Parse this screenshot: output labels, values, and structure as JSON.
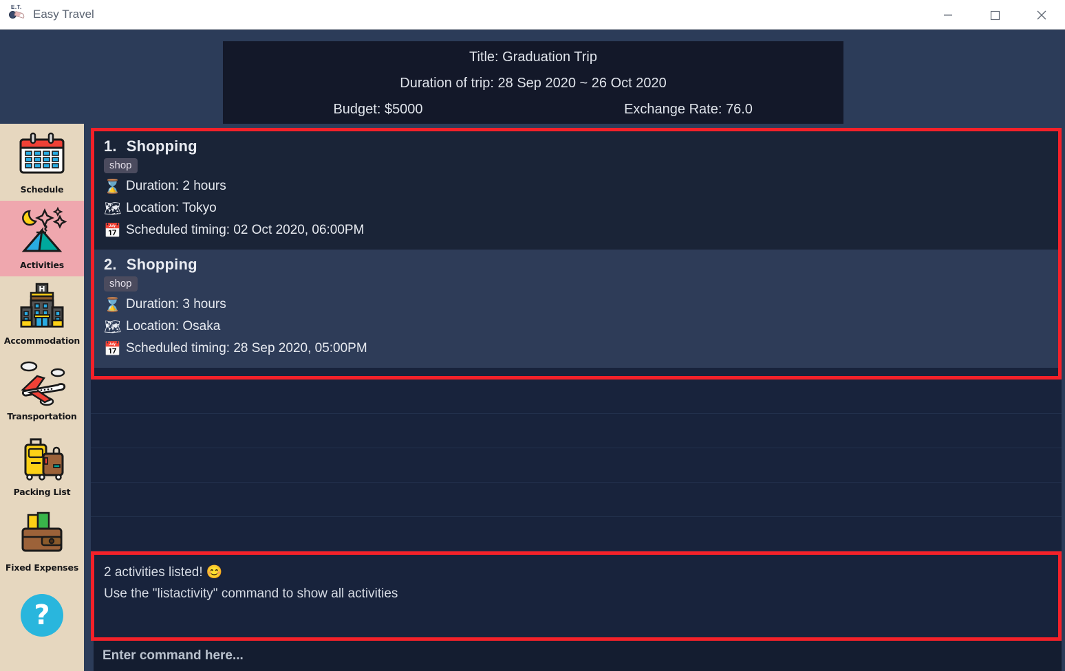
{
  "window": {
    "title": "Easy Travel",
    "logo_text": "E.T.",
    "controls": [
      {
        "name": "minimize",
        "glyph": "minimize-icon"
      },
      {
        "name": "maximize",
        "glyph": "maximize-icon"
      },
      {
        "name": "close",
        "glyph": "close-icon"
      }
    ]
  },
  "trip": {
    "title": "Title: Graduation Trip",
    "duration": "Duration of trip: 28 Sep 2020 ~ 26 Oct 2020",
    "budget": "Budget: $5000",
    "exchange_rate": "Exchange Rate: 76.0"
  },
  "sidebar": {
    "items": [
      {
        "label": "Schedule",
        "icon": "calendar-icon",
        "active": false
      },
      {
        "label": "Activities",
        "icon": "tent-night-icon",
        "active": true
      },
      {
        "label": "Accommodation",
        "icon": "hotel-icon",
        "active": false
      },
      {
        "label": "Transportation",
        "icon": "airplane-icon",
        "active": false
      },
      {
        "label": "Packing List",
        "icon": "luggage-icon",
        "active": false
      },
      {
        "label": "Fixed Expenses",
        "icon": "wallet-icon",
        "active": false
      }
    ],
    "help_label": "?"
  },
  "activities": [
    {
      "index": "1.",
      "name": "Shopping",
      "tag": "shop",
      "duration": "Duration: 2 hours",
      "location": "Location: Tokyo",
      "timing": "Scheduled timing: 02 Oct 2020, 06:00PM",
      "duration_icon": "hourglass-emoji",
      "location_icon": "map-pin-emoji",
      "timing_icon": "calendar-clock-emoji"
    },
    {
      "index": "2.",
      "name": "Shopping",
      "tag": "shop",
      "duration": "Duration: 3 hours",
      "location": "Location: Osaka",
      "timing": "Scheduled timing: 28 Sep 2020, 05:00PM",
      "duration_icon": "hourglass-emoji",
      "location_icon": "map-pin-emoji",
      "timing_icon": "calendar-clock-emoji"
    }
  ],
  "output": {
    "line1": "2 activities listed! 😊",
    "line2": "Use the \"listactivity\" command to show all activities"
  },
  "command": {
    "value": "",
    "placeholder": "Enter command here..."
  },
  "colors": {
    "app_background": "#2c3c59",
    "panel_dark": "#131829",
    "highlight_red": "#f42129",
    "sidebar_bg": "#e6d7bf",
    "sidebar_active": "#efa7ae",
    "accent_help": "#29b6dd"
  }
}
